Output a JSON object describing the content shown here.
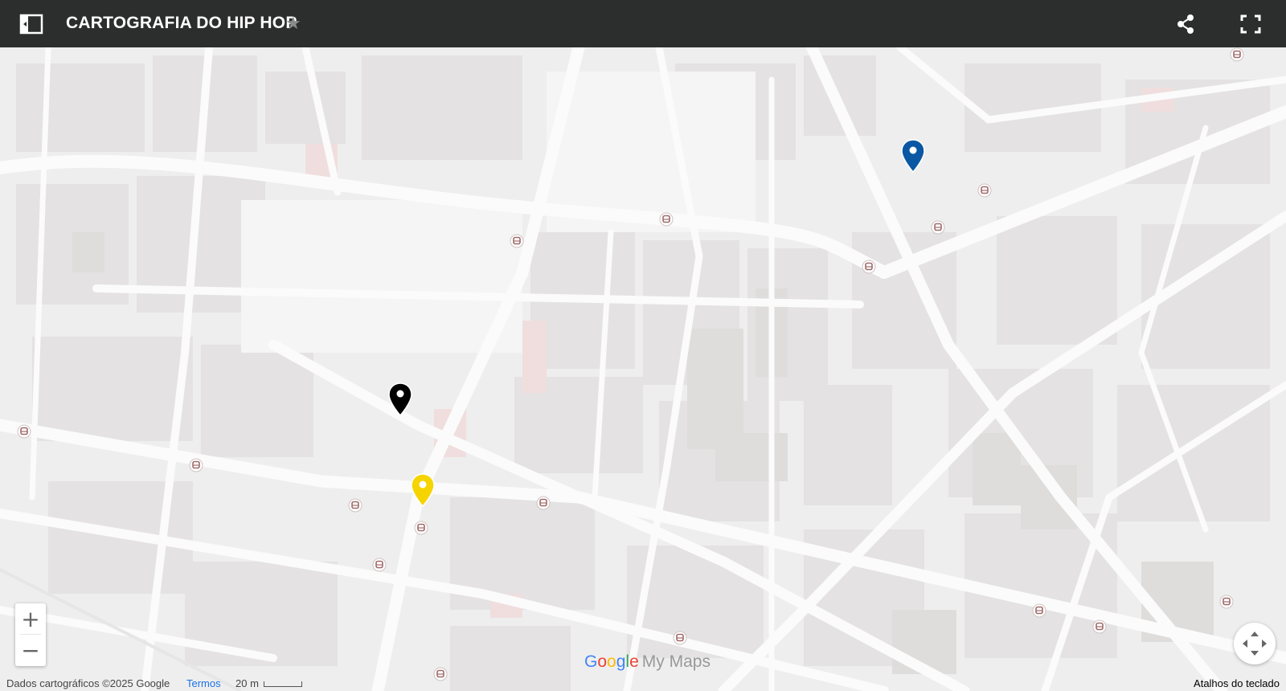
{
  "header": {
    "title": "CARTOGRAFIA DO HIP HOP",
    "star_glyph": "★",
    "panel_icon": "side-panel-icon",
    "share_icon": "share-icon",
    "fullscreen_icon": "fullscreen-icon"
  },
  "map": {
    "markers": [
      {
        "name": "map-marker-blue",
        "color": "#0b57a4"
      },
      {
        "name": "map-marker-black",
        "color": "#000000"
      },
      {
        "name": "map-marker-yellow",
        "color": "#f5d400"
      }
    ],
    "transit_icon": "bus-stop-icon"
  },
  "controls": {
    "zoom_in": "+",
    "zoom_out": "−",
    "recenter_icon": "recenter-icon"
  },
  "logo": {
    "google_letters": [
      "G",
      "o",
      "o",
      "g",
      "l",
      "e"
    ],
    "product": "My Maps"
  },
  "footer": {
    "copyright": "Dados cartográficos ©2025 Google",
    "terms": "Termos",
    "scale": "20 m",
    "shortcuts": "Atalhos do teclado"
  }
}
